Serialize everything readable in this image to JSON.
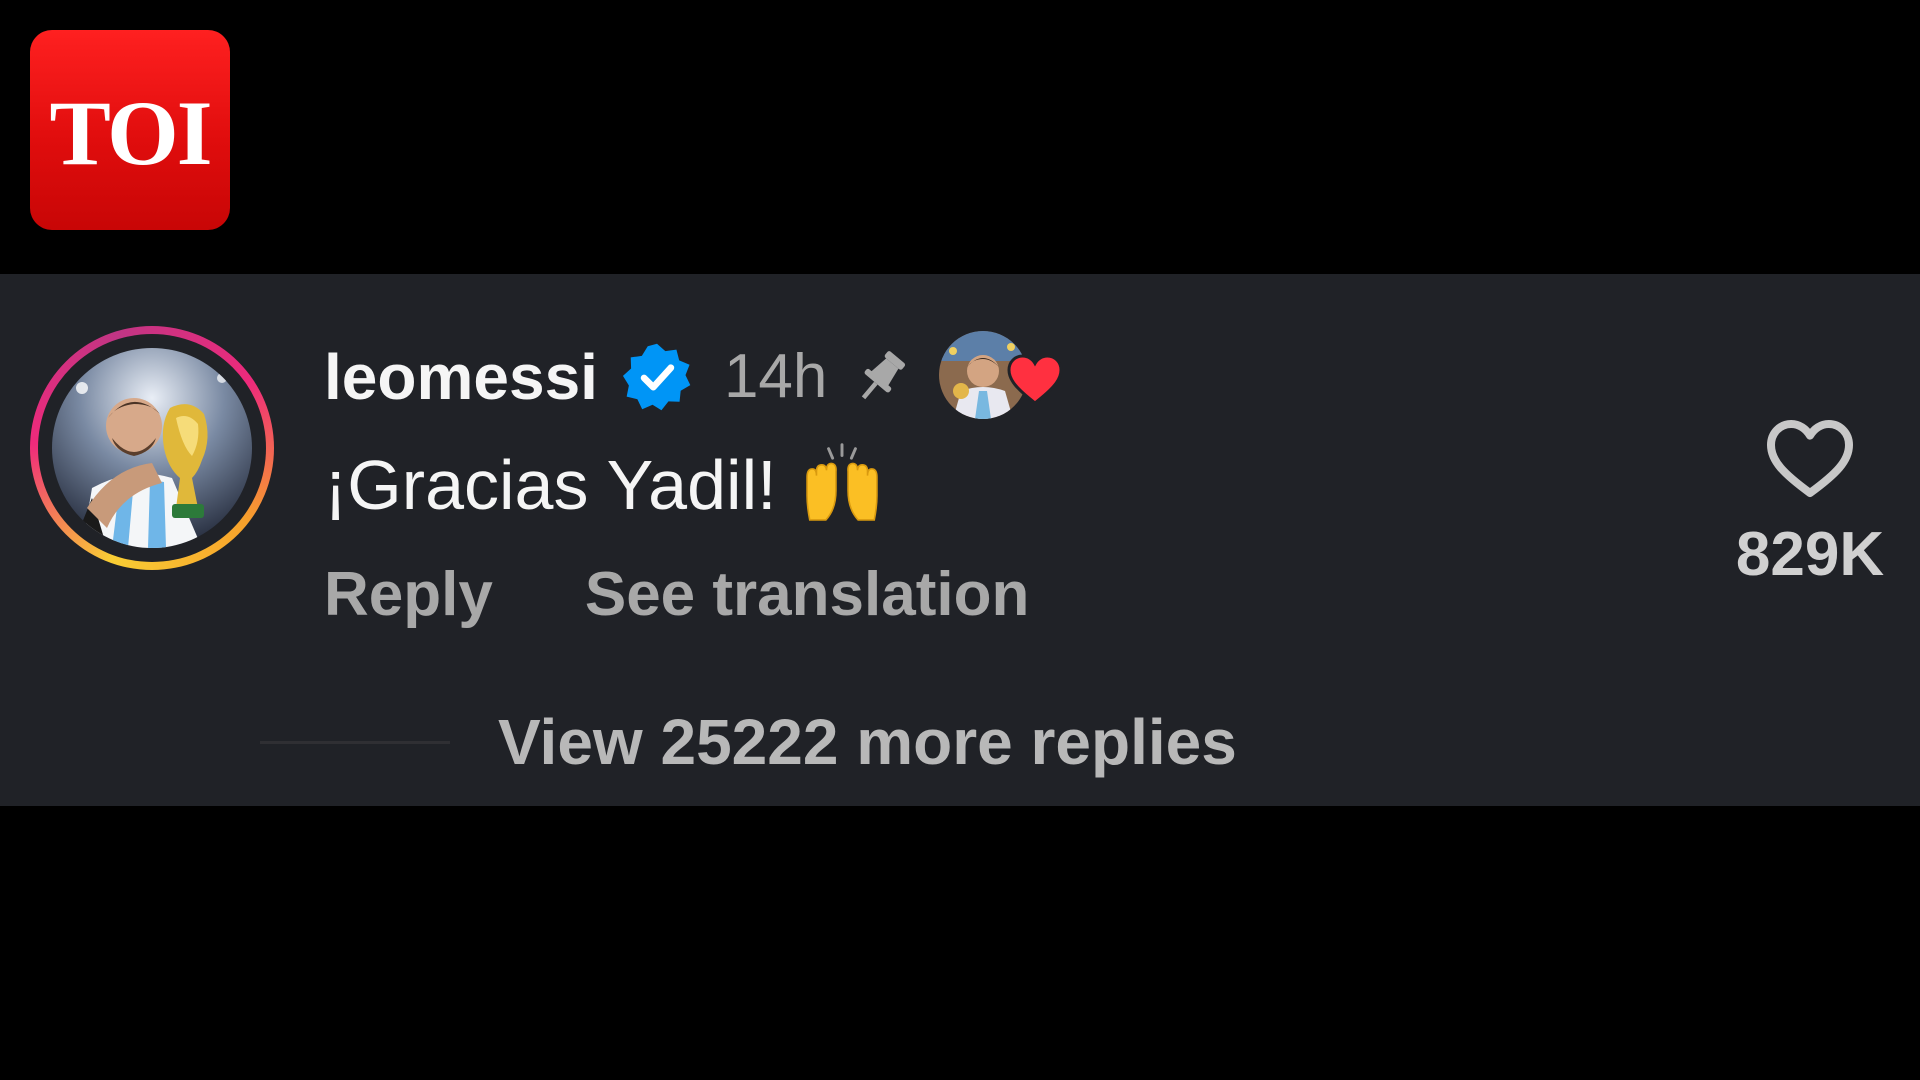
{
  "brand": {
    "logo_text": "TOI",
    "logo_color": "#e41212"
  },
  "comment": {
    "username": "leomessi",
    "verified": true,
    "time": "14h",
    "pinned": true,
    "text": "¡Gracias Yadil!",
    "emoji": "raising-hands",
    "liked_by_author": true,
    "actions": {
      "reply_label": "Reply",
      "translate_label": "See translation"
    },
    "likes": "829K",
    "view_replies_label": "View 25222 more replies"
  },
  "colors": {
    "background": "#000000",
    "panel": "#202227",
    "primary_text": "#f5f5f5",
    "secondary_text": "#a8a8a8",
    "verified_blue": "#0095f6",
    "heart_red": "#ff3040"
  }
}
